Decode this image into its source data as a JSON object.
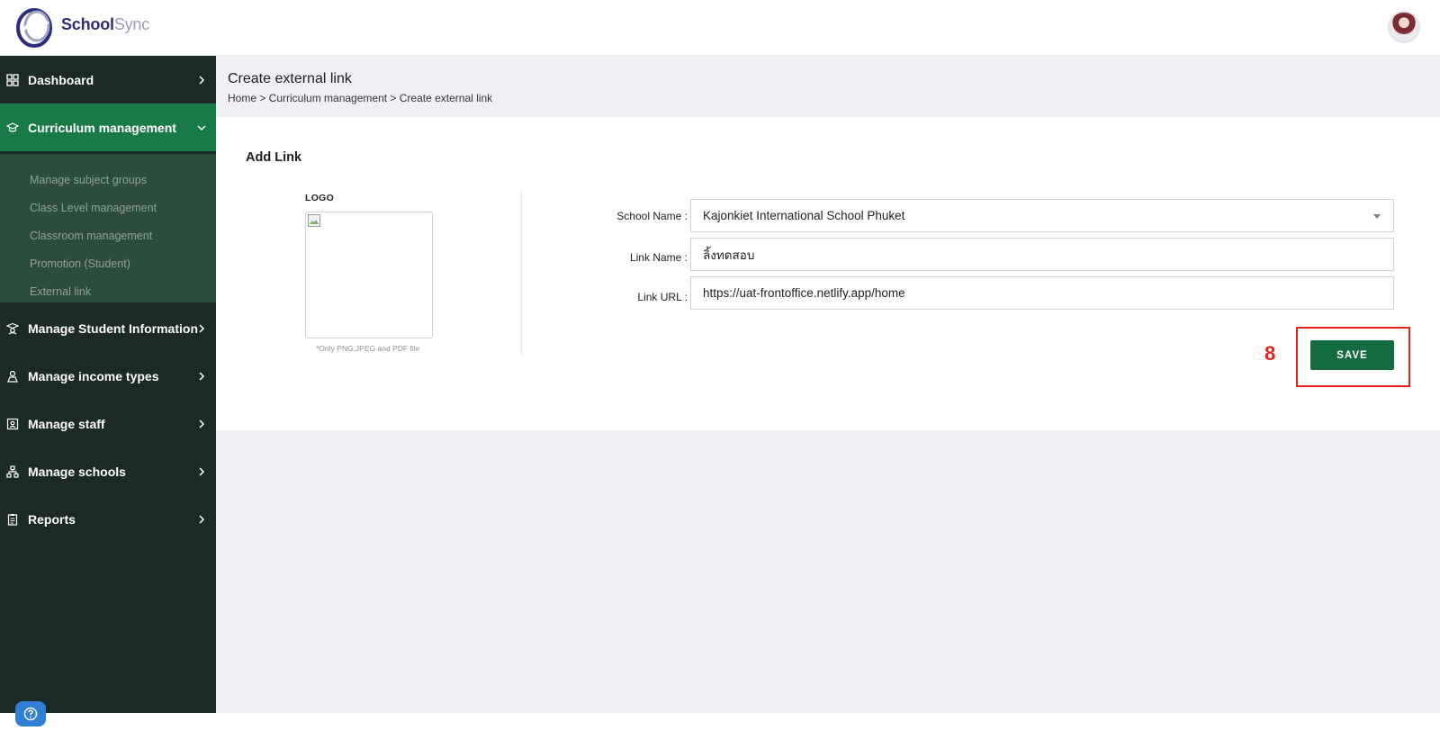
{
  "brand": {
    "part1": "School",
    "part2": "Sync"
  },
  "sidebar": {
    "items": [
      {
        "label": "Dashboard",
        "icon": "dashboard-grid-icon"
      },
      {
        "label": "Curriculum management",
        "icon": "graduation-cap-icon"
      },
      {
        "label": "Manage Student Information",
        "icon": "student-icon"
      },
      {
        "label": "Manage income types",
        "icon": "income-icon"
      },
      {
        "label": "Manage staff",
        "icon": "staff-icon"
      },
      {
        "label": "Manage schools",
        "icon": "school-network-icon"
      },
      {
        "label": "Reports",
        "icon": "clipboard-icon"
      }
    ],
    "submenu": [
      "Manage subject groups",
      "Class Level management",
      "Classroom management",
      "Promotion (Student)",
      "External link"
    ]
  },
  "header": {
    "title": "Create external link",
    "breadcrumb": "Home > Curriculum management > Create external link"
  },
  "form": {
    "card_title": "Add Link",
    "logo_label": "LOGO",
    "logo_note": "*Only PNG,JPEG and PDF file",
    "school_name_label": "School Name :",
    "school_name_value": "Kajonkiet International School Phuket",
    "link_name_label": "Link Name :",
    "link_name_value": "ลิ้งทดสอบ",
    "link_url_label": "Link URL :",
    "link_url_value": "https://uat-frontoffice.netlify.app/home",
    "save_label": "SAVE"
  },
  "annotation": {
    "step_number": "8",
    "color": "#e8201c"
  },
  "colors": {
    "sidebar_bg": "#1b2a26",
    "active_item": "#197a47",
    "submenu_bg": "#2c4d3b",
    "save_button": "#146b3f"
  }
}
